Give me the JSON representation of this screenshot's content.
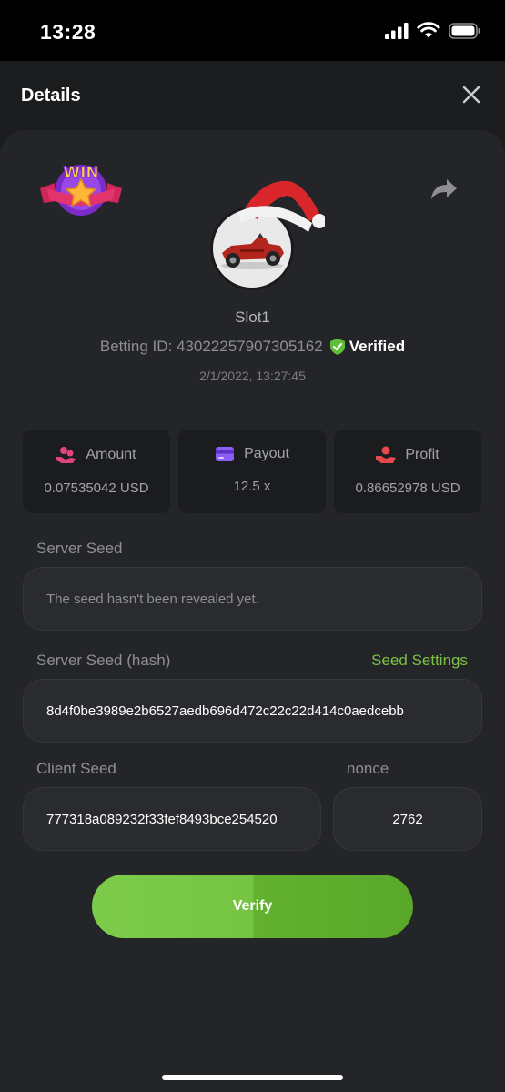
{
  "status_bar": {
    "time": "13:28"
  },
  "header": {
    "title": "Details"
  },
  "bet": {
    "game_name": "Slot1",
    "betting_id": "Betting ID: 43022257907305162",
    "verified_label": "Verified",
    "date": "2/1/2022, 13:27:45",
    "win_badge_text": "WIN"
  },
  "stats": [
    {
      "label": "Amount",
      "value": "0.07535042 USD",
      "icon": "coins-hand-icon",
      "color": "#e0457b"
    },
    {
      "label": "Payout",
      "value": "12.5 x",
      "icon": "card-icon",
      "color": "#8b5cf6"
    },
    {
      "label": "Profit",
      "value": "0.86652978 USD",
      "icon": "money-hand-icon",
      "color": "#e5484d"
    }
  ],
  "fields": {
    "server_seed_label": "Server Seed",
    "server_seed_placeholder": "The seed hasn't been revealed yet.",
    "server_seed_hash_label": "Server Seed (hash)",
    "seed_settings_label": "Seed Settings",
    "server_seed_hash_value": "8d4f0be3989e2b6527aedb696d472c22c22d414c0aedcebb",
    "client_seed_label": "Client Seed",
    "client_seed_value": "777318a089232f33fef8493bce254520",
    "nonce_label": "nonce",
    "nonce_value": "2762"
  },
  "actions": {
    "verify_label": "Verify"
  },
  "colors": {
    "accent_green": "#7bc142",
    "verify_green": "#76c444",
    "background": "#242528"
  }
}
